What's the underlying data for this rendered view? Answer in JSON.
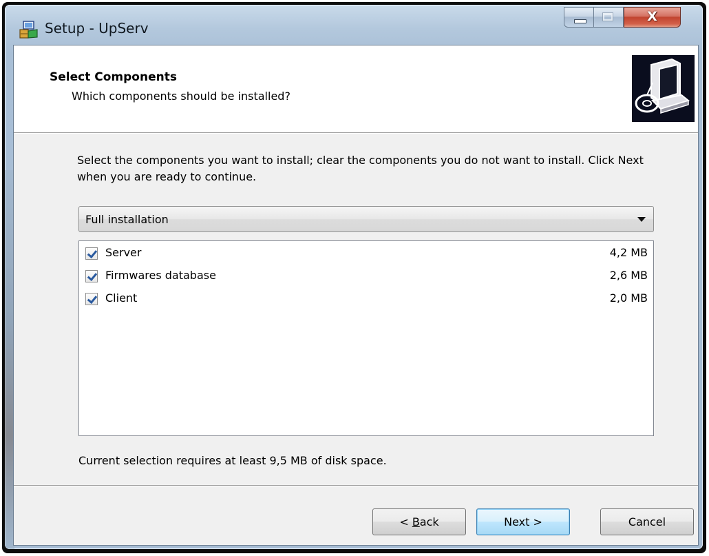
{
  "window": {
    "title": "Setup - UpServ",
    "controls": {
      "close_glyph": "X"
    }
  },
  "header": {
    "title": "Select Components",
    "subtitle": "Which components should be installed?"
  },
  "body": {
    "instructions": "Select the components you want to install; clear the components you do not want to install. Click Next when you are ready to continue.",
    "setup_type": "Full installation",
    "components": [
      {
        "name": "Server",
        "size": "4,2 MB",
        "checked": true
      },
      {
        "name": "Firmwares database",
        "size": "2,6 MB",
        "checked": true
      },
      {
        "name": "Client",
        "size": "2,0 MB",
        "checked": true
      }
    ],
    "disk_space": "Current selection requires at least 9,5 MB of disk space."
  },
  "buttons": {
    "back_prefix": "< ",
    "back_key": "B",
    "back_rest": "ack",
    "next": "Next >",
    "cancel": "Cancel"
  },
  "colors": {
    "window_frame": "#b3c8dd",
    "close_button": "#c1442f",
    "wizard_image_bg": "#0a0d1e",
    "check_mark": "#2a5a9f"
  },
  "icons": {
    "title": "setup-package-icon",
    "wizard": "computer-install-icon"
  }
}
